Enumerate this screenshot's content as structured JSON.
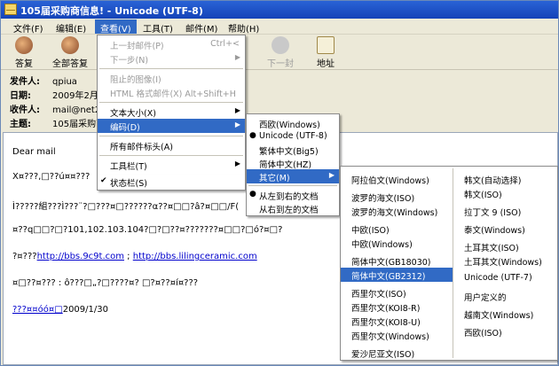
{
  "title": "105届采购商信息! - Unicode (UTF-8)",
  "menubar": [
    "文件(F)",
    "编辑(E)",
    "查看(V)",
    "工具(T)",
    "邮件(M)",
    "帮助(H)"
  ],
  "toolbar": {
    "reply": "答复",
    "reply_all": "全部答复",
    "next": "下一封",
    "addresses": "地址"
  },
  "headers": {
    "from_label": "发件人:",
    "from": "qpiua",
    "date_label": "日期:",
    "date": "2009年2月2",
    "to_label": "收件人:",
    "to": "mail@net2",
    "subject_label": "主题:",
    "subject": "105届采购商"
  },
  "body": {
    "line1": "Dear mail",
    "line2": "Χ¤???,□??ú¤¤???",
    "line3": "Ì?????組???Ì???¨?□???¤□??????α??¤□□?â?¤□□/F(",
    "line4": "¤??q□□?□?101,102.103.104?□?□??¤???????¤□□?□ó?¤□?",
    "line5_prefix": "?¤???",
    "link1": "http://bbs.9c9t.com",
    "sep": " ; ",
    "link2": "http://bbs.lilingceramic.com",
    "line6": "¤□??¤??? : ô???□„?□????¤?  □?¤??¤í¤???",
    "line7_link": "???¤¤óó¤□",
    "line7_date": "2009/1/30"
  },
  "view_menu": {
    "items": [
      {
        "label": "上一封邮件(P)",
        "shortcut": "Ctrl+<",
        "disabled": true
      },
      {
        "label": "下一步(N)",
        "disabled": true,
        "arrow": true
      },
      {
        "label": "阻止的图像(I)",
        "disabled": true
      },
      {
        "label": "HTML 格式邮件(X)  Alt+Shift+H",
        "disabled": true
      },
      {
        "label": "文本大小(X)",
        "arrow": true
      },
      {
        "label": "编码(D)",
        "arrow": true,
        "highlight": true
      },
      {
        "label": "所有邮件标头(A)"
      },
      {
        "label": "工具栏(T)",
        "arrow": true
      },
      {
        "label": "状态栏(S)",
        "checked": true
      }
    ]
  },
  "encoding_menu": {
    "items": [
      {
        "label": "西欧(Windows)"
      },
      {
        "label": "Unicode (UTF-8)",
        "bullet": true
      },
      {
        "label": "繁体中文(Big5)"
      },
      {
        "label": "简体中文(HZ)"
      },
      {
        "label": "其它(M)",
        "arrow": true,
        "highlight": true
      },
      {
        "label": "从左到右的文档",
        "bullet": true
      },
      {
        "label": "从右到左的文档"
      }
    ]
  },
  "other_menu_col1": [
    "阿拉伯文(Windows)",
    "波罗的海文(ISO)",
    "波罗的海文(Windows)",
    "中欧(ISO)",
    "中欧(Windows)",
    "简体中文(GB18030)",
    "简体中文(GB2312)",
    "西里尔文(ISO)",
    "西里尔文(KOI8-R)",
    "西里尔文(KOI8-U)",
    "西里尔文(Windows)",
    "爱沙尼亚文(ISO)"
  ],
  "other_menu_col2": [
    "韩文(自动选择)",
    "韩文(ISO)",
    "拉丁文 9 (ISO)",
    "泰文(Windows)",
    "土耳其文(ISO)",
    "土耳其文(Windows)",
    "Unicode (UTF-7)",
    "用户定义的",
    "越南文(Windows)",
    "西欧(ISO)"
  ]
}
